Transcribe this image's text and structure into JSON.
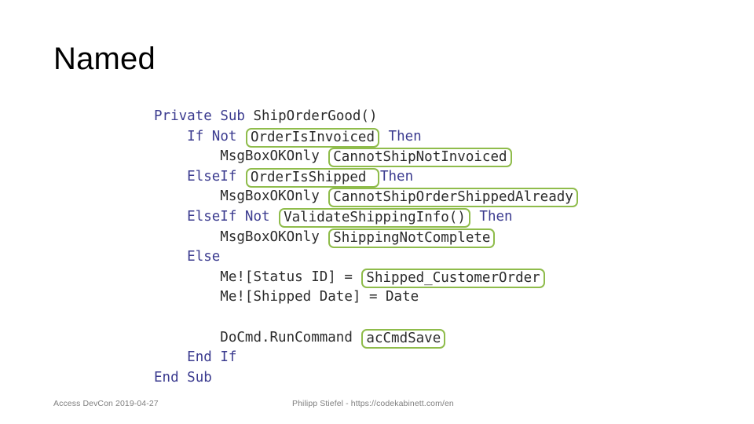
{
  "slide": {
    "title": "Named",
    "background_color": "#FFFFFF",
    "highlight_color": "#8FBC4B",
    "keyword_color": "#3B3B8F",
    "code_color": "#2B2B2B"
  },
  "code": {
    "language": "VBA",
    "lines": [
      {
        "indent": 0,
        "tokens": [
          {
            "t": "Private",
            "k": "kw"
          },
          {
            "t": " ",
            "k": "pl"
          },
          {
            "t": "Sub",
            "k": "kw"
          },
          {
            "t": " ",
            "k": "pl"
          },
          {
            "t": "ShipOrderGood()",
            "k": "pl"
          }
        ]
      },
      {
        "indent": 1,
        "tokens": [
          {
            "t": "If",
            "k": "kw"
          },
          {
            "t": " ",
            "k": "pl"
          },
          {
            "t": "Not",
            "k": "kw"
          },
          {
            "t": " ",
            "k": "pl"
          },
          {
            "t": "OrderIsInvoiced",
            "k": "hl"
          },
          {
            "t": " ",
            "k": "pl"
          },
          {
            "t": "Then",
            "k": "kw"
          }
        ]
      },
      {
        "indent": 2,
        "tokens": [
          {
            "t": "MsgBoxOKOnly ",
            "k": "pl"
          },
          {
            "t": "CannotShipNotInvoiced",
            "k": "hl"
          }
        ]
      },
      {
        "indent": 1,
        "tokens": [
          {
            "t": "ElseIf",
            "k": "kw"
          },
          {
            "t": " ",
            "k": "pl"
          },
          {
            "t": "OrderIsShipped ",
            "k": "hl"
          },
          {
            "t": "Then",
            "k": "kw"
          }
        ]
      },
      {
        "indent": 2,
        "tokens": [
          {
            "t": "MsgBoxOKOnly ",
            "k": "pl"
          },
          {
            "t": "CannotShipOrderShippedAlready",
            "k": "hl"
          }
        ]
      },
      {
        "indent": 1,
        "tokens": [
          {
            "t": "ElseIf",
            "k": "kw"
          },
          {
            "t": " ",
            "k": "pl"
          },
          {
            "t": "Not",
            "k": "kw"
          },
          {
            "t": " ",
            "k": "pl"
          },
          {
            "t": "ValidateShippingInfo()",
            "k": "hl"
          },
          {
            "t": " ",
            "k": "pl"
          },
          {
            "t": "Then",
            "k": "kw"
          }
        ]
      },
      {
        "indent": 2,
        "tokens": [
          {
            "t": "MsgBoxOKOnly ",
            "k": "pl"
          },
          {
            "t": "ShippingNotComplete",
            "k": "hl"
          }
        ]
      },
      {
        "indent": 1,
        "tokens": [
          {
            "t": "Else",
            "k": "kw"
          }
        ]
      },
      {
        "indent": 2,
        "tokens": [
          {
            "t": "Me![Status ID] = ",
            "k": "pl"
          },
          {
            "t": "Shipped_CustomerOrder",
            "k": "hl"
          }
        ]
      },
      {
        "indent": 2,
        "tokens": [
          {
            "t": "Me![Shipped Date] = Date",
            "k": "pl"
          }
        ]
      },
      {
        "indent": 0,
        "tokens": []
      },
      {
        "indent": 2,
        "tokens": [
          {
            "t": "DoCmd.RunCommand ",
            "k": "pl"
          },
          {
            "t": "acCmdSave",
            "k": "hl"
          }
        ]
      },
      {
        "indent": 1,
        "tokens": [
          {
            "t": "End",
            "k": "kw"
          },
          {
            "t": " ",
            "k": "pl"
          },
          {
            "t": "If",
            "k": "kw"
          }
        ]
      },
      {
        "indent": 0,
        "tokens": [
          {
            "t": "End",
            "k": "kw"
          },
          {
            "t": " ",
            "k": "pl"
          },
          {
            "t": "Sub",
            "k": "kw"
          }
        ]
      }
    ]
  },
  "footer": {
    "left": "Access DevCon 2019-04-27",
    "center": "Philipp Stiefel - https://codekabinett.com/en"
  }
}
